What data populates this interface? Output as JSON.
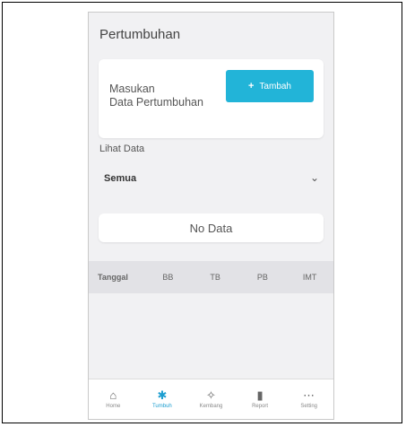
{
  "header": {
    "title": "Pertumbuhan"
  },
  "entry_card": {
    "prompt_line1": "Masukan",
    "prompt_line2": "Data Pertumbuhan",
    "add_button_label": "Tambah"
  },
  "filter": {
    "label": "Lihat Data",
    "selected": "Semua"
  },
  "empty_state": {
    "message": "No Data"
  },
  "table": {
    "columns": [
      "Tanggal",
      "BB",
      "TB",
      "PB",
      "IMT"
    ]
  },
  "bottom_nav": {
    "items": [
      {
        "label": "Home",
        "icon": "home-icon",
        "active": false
      },
      {
        "label": "Tumbuh",
        "icon": "growth-icon",
        "active": true
      },
      {
        "label": "Kembang",
        "icon": "walk-icon",
        "active": false
      },
      {
        "label": "Report",
        "icon": "bar-chart-icon",
        "active": false
      },
      {
        "label": "Setting",
        "icon": "more-icon",
        "active": false
      }
    ]
  },
  "colors": {
    "accent": "#22b4d8",
    "nav_active": "#1d9ed0"
  }
}
